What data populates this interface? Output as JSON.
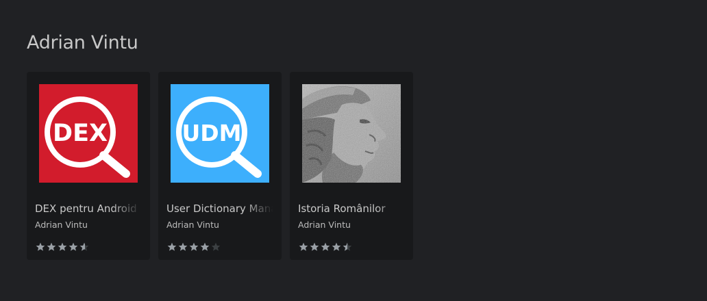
{
  "developer": {
    "name": "Adrian Vintu"
  },
  "colors": {
    "background": "#202124",
    "card": "#18191b",
    "star_filled": "#9aa0a6",
    "star_empty": "#3c4043",
    "dex_icon": "#d21c2c",
    "udm_icon": "#3daffc"
  },
  "apps": [
    {
      "name": "DEX pentru Android",
      "developer": "Adrian Vintu",
      "rating": 4.6,
      "rating_max": 5,
      "icon": "dex-magnifier-icon",
      "icon_text": "DEX"
    },
    {
      "name": "User Dictionary Manager",
      "developer": "Adrian Vintu",
      "rating": 4.0,
      "rating_max": 5,
      "icon": "udm-magnifier-icon",
      "icon_text": "UDM"
    },
    {
      "name": "Istoria Românilor",
      "developer": "Adrian Vintu",
      "rating": 4.5,
      "rating_max": 5,
      "icon": "stone-relief-portrait-image"
    }
  ]
}
